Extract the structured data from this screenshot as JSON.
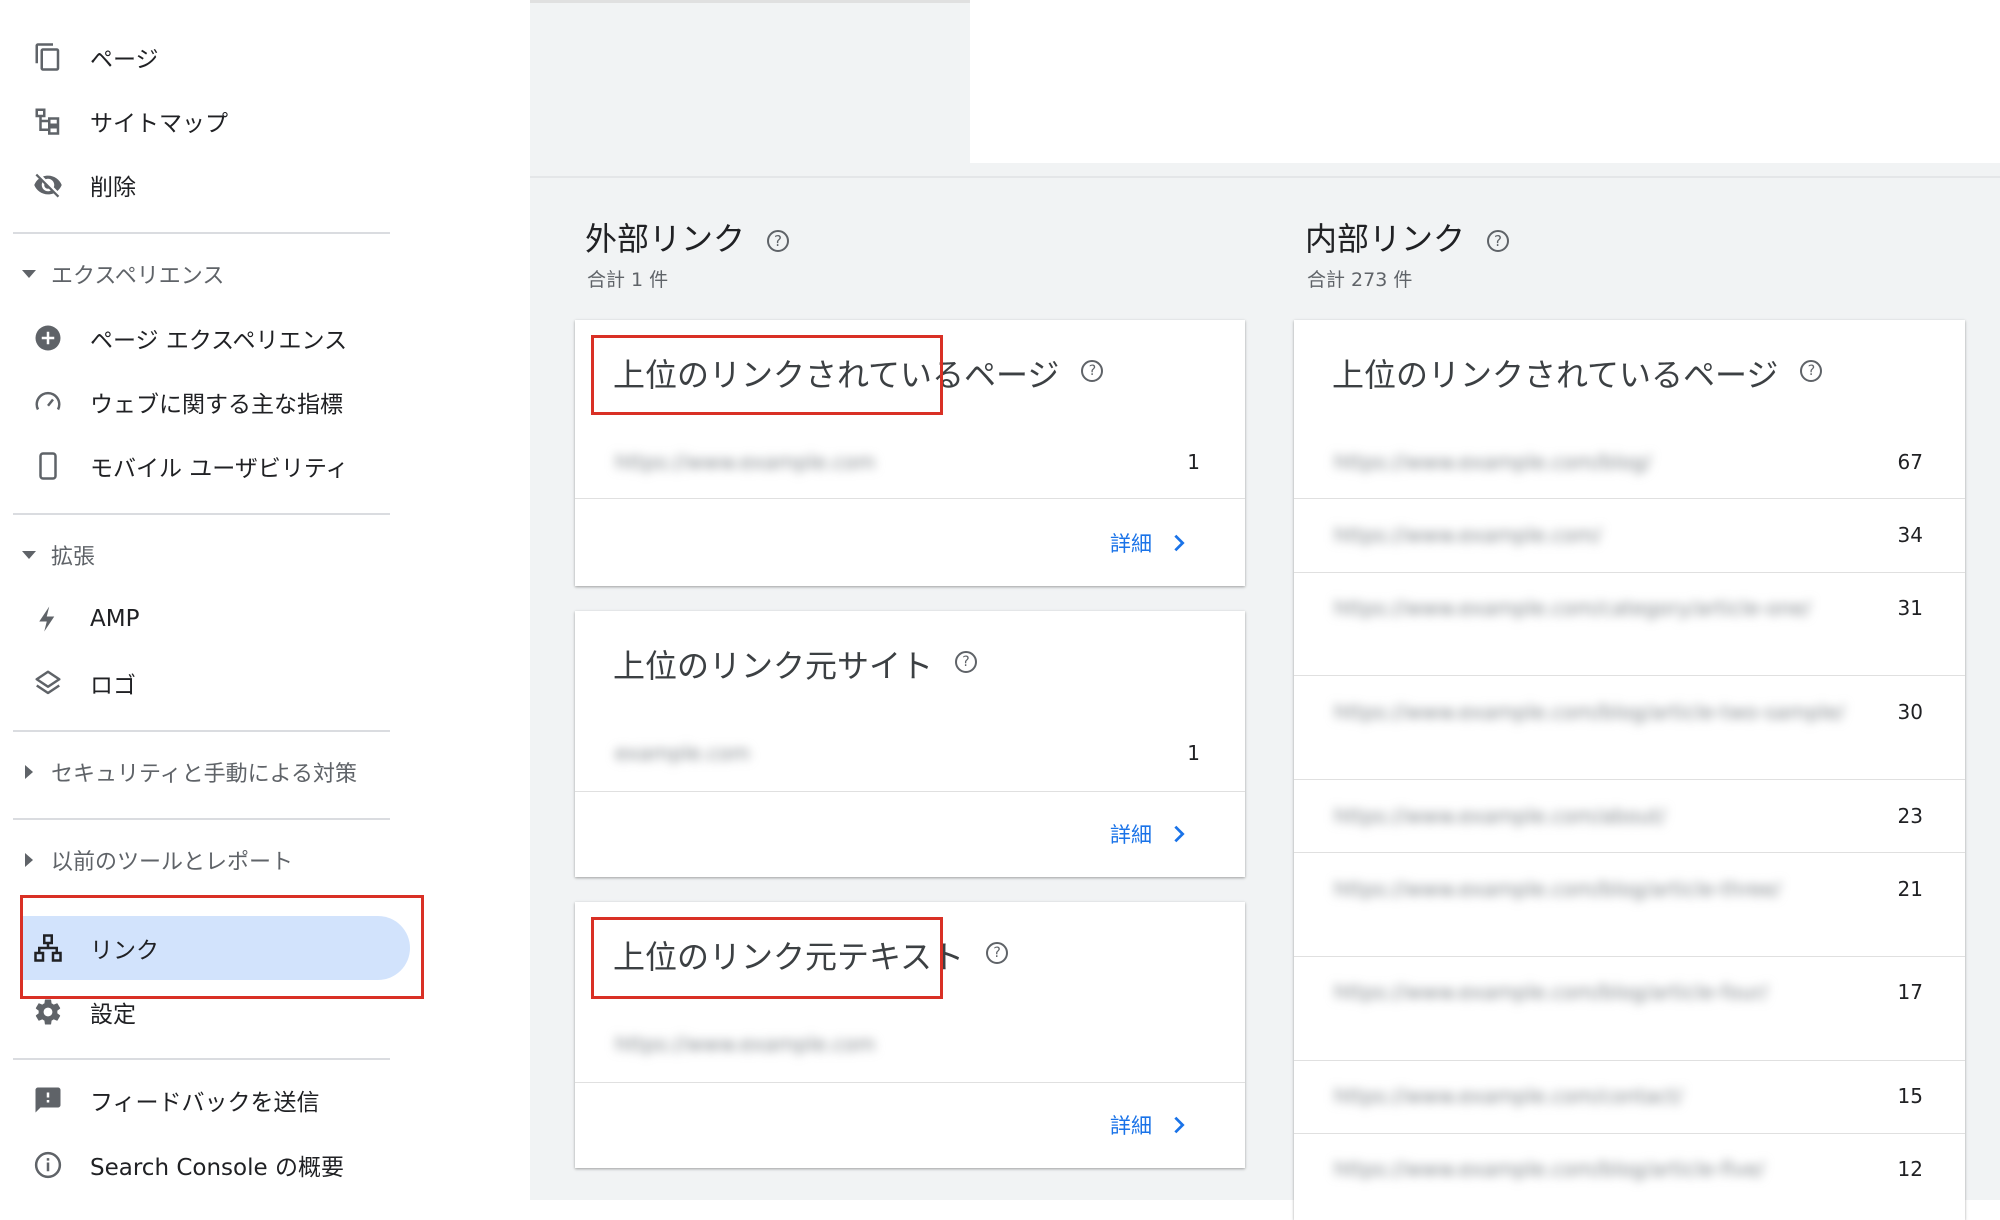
{
  "sidebar": {
    "top_items": [
      {
        "label": "ページ",
        "icon": "pages-icon"
      },
      {
        "label": "サイトマップ",
        "icon": "sitemap-icon"
      },
      {
        "label": "削除",
        "icon": "removals-icon"
      }
    ],
    "experience": {
      "header": "エクスペリエンス",
      "items": [
        {
          "label": "ページ エクスペリエンス",
          "icon": "page-experience-icon"
        },
        {
          "label": "ウェブに関する主な指標",
          "icon": "speedometer-icon"
        },
        {
          "label": "モバイル ユーザビリティ",
          "icon": "mobile-phone-icon"
        }
      ]
    },
    "enhancements": {
      "header": "拡張",
      "items": [
        {
          "label": "AMP",
          "icon": "lightning-icon"
        },
        {
          "label": "ロゴ",
          "icon": "layers-icon"
        }
      ]
    },
    "security_header": "セキュリティと手動による対策",
    "legacy_header": "以前のツールとレポート",
    "links_item": {
      "label": "リンク",
      "icon": "links-icon"
    },
    "settings_item": {
      "label": "設定",
      "icon": "gear-icon"
    },
    "feedback_item": {
      "label": "フィードバックを送信",
      "icon": "feedback-icon"
    },
    "about_item": {
      "label": "Search Console の概要",
      "icon": "info-icon"
    }
  },
  "external": {
    "title": "外部リンク",
    "total": "合計 1 件",
    "cards": [
      {
        "title": "上位のリンクされているページ",
        "rows": [
          {
            "text": "https://www.example.com",
            "value": "1"
          }
        ],
        "detail": "詳細"
      },
      {
        "title": "上位のリンク元サイト",
        "rows": [
          {
            "text": "example.com",
            "value": "1"
          }
        ],
        "detail": "詳細"
      },
      {
        "title": "上位のリンク元テキスト",
        "rows": [
          {
            "text": "https://www.example.com",
            "value": ""
          }
        ],
        "detail": "詳細"
      }
    ]
  },
  "internal": {
    "title": "内部リンク",
    "total": "合計 273 件",
    "card_title": "上位のリンクされているページ",
    "rows": [
      {
        "text": "https://www.example.com/blog/",
        "value": "67"
      },
      {
        "text": "https://www.example.com/",
        "value": "34"
      },
      {
        "text": "https://www.example.com/category/article-one/",
        "value": "31"
      },
      {
        "text": "https://www.example.com/blog/article-two-sample/",
        "value": "30"
      },
      {
        "text": "https://www.example.com/about/",
        "value": "23"
      },
      {
        "text": "https://www.example.com/blog/article-three/",
        "value": "21"
      },
      {
        "text": "https://www.example.com/blog/article-four/",
        "value": "17"
      },
      {
        "text": "https://www.example.com/contact/",
        "value": "15"
      },
      {
        "text": "https://www.example.com/blog/article-five/",
        "value": "12"
      }
    ]
  }
}
